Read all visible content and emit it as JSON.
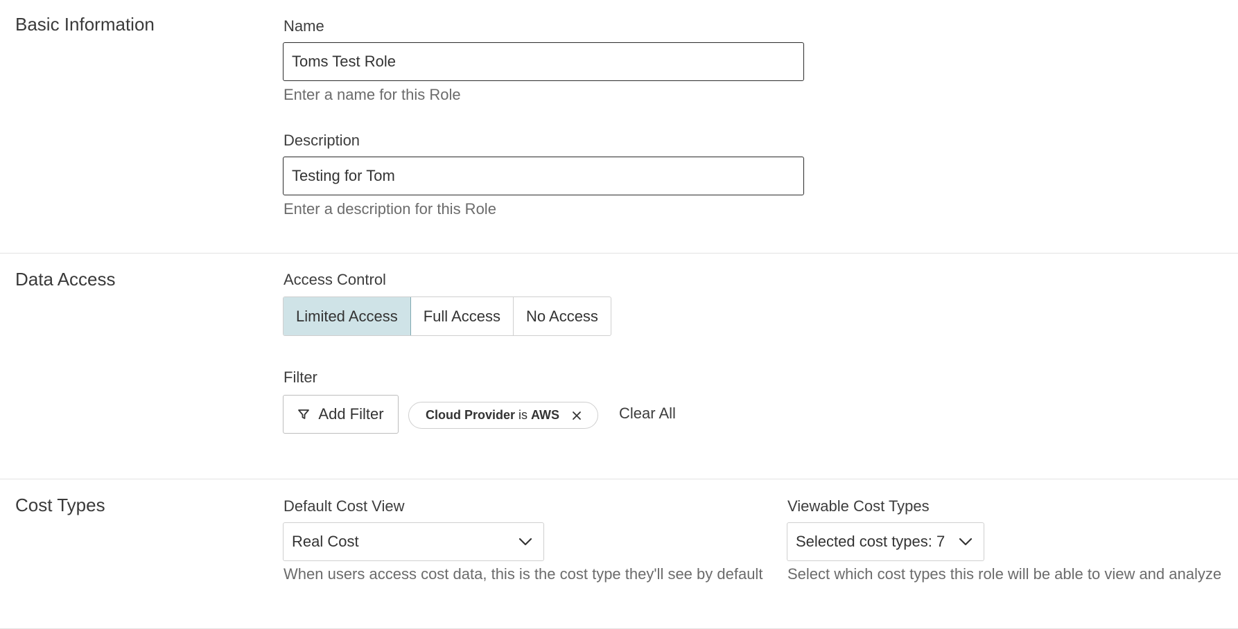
{
  "basic": {
    "title": "Basic Information",
    "name_label": "Name",
    "name_value": "Toms Test Role",
    "name_help": "Enter a name for this Role",
    "description_label": "Description",
    "description_value": "Testing for Tom",
    "description_help": "Enter a description for this Role"
  },
  "data_access": {
    "title": "Data Access",
    "access_control_label": "Access Control",
    "options": [
      "Limited Access",
      "Full Access",
      "No Access"
    ],
    "selected": "Limited Access",
    "filter_label": "Filter",
    "add_filter_label": "Add Filter",
    "chip": {
      "field": "Cloud Provider",
      "operator": "is",
      "value": "AWS"
    },
    "clear_all_label": "Clear All"
  },
  "cost_types": {
    "title": "Cost Types",
    "default_view_label": "Default Cost View",
    "default_view_value": "Real Cost",
    "default_view_help": "When users access cost data, this is the cost type they'll see by default",
    "viewable_label": "Viewable Cost Types",
    "viewable_value": "Selected cost types: 7",
    "viewable_help": "Select which cost types this role will be able to view and analyze"
  },
  "icons": {
    "filter": "filter-funnel-icon",
    "close": "close-icon",
    "chevron": "chevron-down-icon"
  },
  "colors": {
    "active_segment_bg": "#cfe3e7",
    "active_segment_border": "#7fa8b1",
    "input_border": "#2a2a2a"
  }
}
